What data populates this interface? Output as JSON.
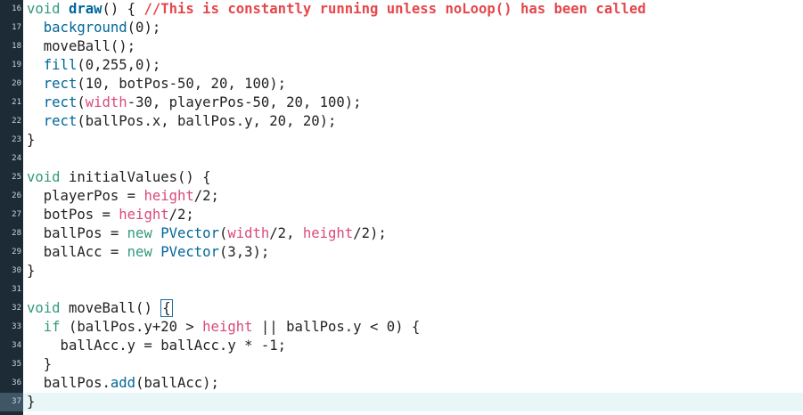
{
  "editor": {
    "current_line": 37,
    "lines": [
      {
        "num": "16",
        "tokens": [
          {
            "t": "void",
            "c": "kw"
          },
          {
            "t": " ",
            "c": ""
          },
          {
            "t": "draw",
            "c": "fn bold"
          },
          {
            "t": "() { ",
            "c": ""
          },
          {
            "t": "//This is constantly running unless noLoop() has been called",
            "c": "comment"
          }
        ]
      },
      {
        "num": "17",
        "tokens": [
          {
            "t": "  ",
            "c": ""
          },
          {
            "t": "background",
            "c": "fn"
          },
          {
            "t": "(0);",
            "c": ""
          }
        ]
      },
      {
        "num": "18",
        "tokens": [
          {
            "t": "  moveBall();",
            "c": ""
          }
        ]
      },
      {
        "num": "19",
        "tokens": [
          {
            "t": "  ",
            "c": ""
          },
          {
            "t": "fill",
            "c": "fn"
          },
          {
            "t": "(0,255,0);",
            "c": ""
          }
        ]
      },
      {
        "num": "20",
        "tokens": [
          {
            "t": "  ",
            "c": ""
          },
          {
            "t": "rect",
            "c": "fn"
          },
          {
            "t": "(10, botPos-50, 20, 100);",
            "c": ""
          }
        ]
      },
      {
        "num": "21",
        "tokens": [
          {
            "t": "  ",
            "c": ""
          },
          {
            "t": "rect",
            "c": "fn"
          },
          {
            "t": "(",
            "c": ""
          },
          {
            "t": "width",
            "c": "builtin"
          },
          {
            "t": "-30, playerPos-50, 20, 100);",
            "c": ""
          }
        ]
      },
      {
        "num": "22",
        "tokens": [
          {
            "t": "  ",
            "c": ""
          },
          {
            "t": "rect",
            "c": "fn"
          },
          {
            "t": "(ballPos.x, ballPos.y, 20, 20);",
            "c": ""
          }
        ]
      },
      {
        "num": "23",
        "tokens": [
          {
            "t": "}",
            "c": ""
          }
        ]
      },
      {
        "num": "24",
        "tokens": []
      },
      {
        "num": "25",
        "tokens": [
          {
            "t": "void",
            "c": "kw"
          },
          {
            "t": " initialValues() {",
            "c": ""
          }
        ]
      },
      {
        "num": "26",
        "tokens": [
          {
            "t": "  playerPos = ",
            "c": ""
          },
          {
            "t": "height",
            "c": "builtin"
          },
          {
            "t": "/2;",
            "c": ""
          }
        ]
      },
      {
        "num": "27",
        "tokens": [
          {
            "t": "  botPos = ",
            "c": ""
          },
          {
            "t": "height",
            "c": "builtin"
          },
          {
            "t": "/2;",
            "c": ""
          }
        ]
      },
      {
        "num": "28",
        "tokens": [
          {
            "t": "  ballPos = ",
            "c": ""
          },
          {
            "t": "new",
            "c": "kw"
          },
          {
            "t": " ",
            "c": ""
          },
          {
            "t": "PVector",
            "c": "fn"
          },
          {
            "t": "(",
            "c": ""
          },
          {
            "t": "width",
            "c": "builtin"
          },
          {
            "t": "/2, ",
            "c": ""
          },
          {
            "t": "height",
            "c": "builtin"
          },
          {
            "t": "/2);",
            "c": ""
          }
        ]
      },
      {
        "num": "29",
        "tokens": [
          {
            "t": "  ballAcc = ",
            "c": ""
          },
          {
            "t": "new",
            "c": "kw"
          },
          {
            "t": " ",
            "c": ""
          },
          {
            "t": "PVector",
            "c": "fn"
          },
          {
            "t": "(3,3);",
            "c": ""
          }
        ]
      },
      {
        "num": "30",
        "tokens": [
          {
            "t": "}",
            "c": ""
          }
        ]
      },
      {
        "num": "31",
        "tokens": []
      },
      {
        "num": "32",
        "tokens": [
          {
            "t": "void",
            "c": "kw"
          },
          {
            "t": " moveBall() ",
            "c": ""
          },
          {
            "t": "{",
            "c": "cursor-box"
          }
        ]
      },
      {
        "num": "33",
        "tokens": [
          {
            "t": "  ",
            "c": ""
          },
          {
            "t": "if",
            "c": "kw"
          },
          {
            "t": " (ballPos.y+20 > ",
            "c": ""
          },
          {
            "t": "height",
            "c": "builtin"
          },
          {
            "t": " || ballPos.y < 0) {",
            "c": ""
          }
        ]
      },
      {
        "num": "34",
        "tokens": [
          {
            "t": "    ballAcc.y = ballAcc.y * -1;",
            "c": ""
          }
        ]
      },
      {
        "num": "35",
        "tokens": [
          {
            "t": "  }",
            "c": ""
          }
        ]
      },
      {
        "num": "36",
        "tokens": [
          {
            "t": "  ballPos.",
            "c": ""
          },
          {
            "t": "add",
            "c": "fn"
          },
          {
            "t": "(ballAcc);",
            "c": ""
          }
        ]
      },
      {
        "num": "37",
        "tokens": [
          {
            "t": "}",
            "c": ""
          }
        ]
      }
    ]
  }
}
